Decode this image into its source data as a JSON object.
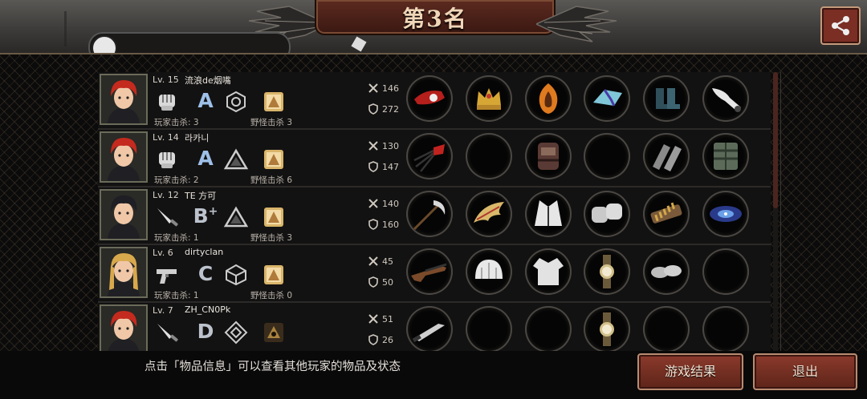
{
  "header": {
    "rank_title": "第3名",
    "player_name": "———"
  },
  "players": [
    {
      "level": "Lv. 15",
      "name": "流浪de烟嘴",
      "weapon_icon": "fist-icon",
      "grade": "A",
      "grade_plus": "",
      "skill_icon": "hexagon-skill-icon",
      "emblem_icon": "gold-emblem-icon",
      "player_kills": "玩家击杀: 3",
      "monster_kills": "野怪击杀 3",
      "attack": "146",
      "defense": "272",
      "hair": "#c42a1e",
      "items": [
        "red-bone-gauntlet-icon",
        "royal-crown-icon",
        "flame-armor-icon",
        "crystal-bracelet-icon",
        "teal-boots-icon",
        "white-feather-ornament-icon"
      ]
    },
    {
      "level": "Lv. 14",
      "name": "라카니",
      "weapon_icon": "fist-icon",
      "grade": "A",
      "grade_plus": "",
      "skill_icon": "triangle-skill-icon",
      "emblem_icon": "gold-emblem-icon",
      "player_kills": "玩家击杀: 2",
      "monster_kills": "野怪击杀 6",
      "attack": "130",
      "defense": "147",
      "hair": "#c42a1e",
      "items": [
        "claw-gauntlet-icon",
        "empty",
        "tactical-armor-icon",
        "empty",
        "leg-wraps-icon",
        "plate-armor-icon"
      ]
    },
    {
      "level": "Lv. 12",
      "name": "TE 方可",
      "weapon_icon": "knife-icon",
      "grade": "B",
      "grade_plus": "+",
      "skill_icon": "triangle-skill-icon",
      "emblem_icon": "gold-emblem-icon",
      "player_kills": "玩家击杀: 1",
      "monster_kills": "野怪击杀 3",
      "attack": "140",
      "defense": "160",
      "hair": "#1e1e24",
      "items": [
        "scythe-icon",
        "golden-wing-icon",
        "white-suit-icon",
        "silver-gloves-icon",
        "bullet-belt-icon",
        "galaxy-bracelet-icon"
      ]
    },
    {
      "level": "Lv. 6",
      "name": "dirtyclan",
      "weapon_icon": "pistol-icon",
      "grade": "C",
      "grade_plus": "",
      "skill_icon": "cube-skill-icon",
      "emblem_icon": "gold-emblem-icon",
      "player_kills": "玩家击杀: 1",
      "monster_kills": "野怪击杀 0",
      "attack": "45",
      "defense": "50",
      "hair": "#d8a84c",
      "items": [
        "shotgun-icon",
        "white-helmet-icon",
        "white-shirt-icon",
        "wrist-watch-icon",
        "slippers-icon",
        "empty"
      ]
    },
    {
      "level": "Lv. 7",
      "name": "ZH_CN0Pk",
      "weapon_icon": "knife-icon",
      "grade": "D",
      "grade_plus": "",
      "skill_icon": "diamond-skill-icon",
      "emblem_icon": "dark-emblem-icon",
      "player_kills": "",
      "monster_kills": "",
      "attack": "51",
      "defense": "26",
      "hair": "#c42a1e",
      "items": [
        "combat-knife-icon",
        "empty",
        "empty",
        "wrist-watch-icon",
        "empty",
        "empty"
      ]
    }
  ],
  "footer": {
    "hint": "点击「物品信息」可以查看其他玩家的物品及状态",
    "result_button": "游戏结果",
    "exit_button": "退出"
  },
  "colors": {
    "accent_red": "#7a2e24",
    "panel_bg": "#131212",
    "grade_a": "#9ec0e8"
  }
}
